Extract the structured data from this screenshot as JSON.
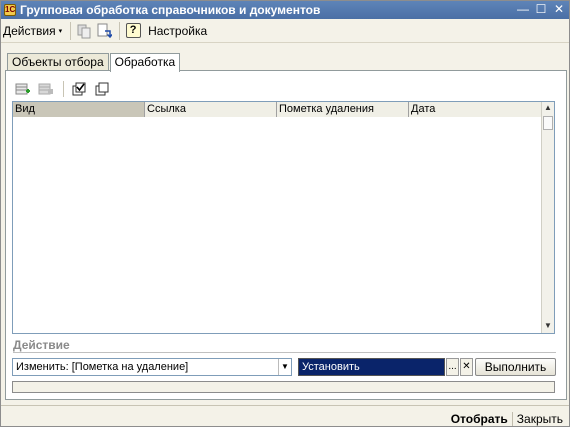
{
  "window": {
    "title": "Групповая обработка справочников и документов",
    "app_icon_glyph": "1С",
    "buttons": {
      "minimize": "—",
      "maximize": "☐",
      "close": "✕"
    }
  },
  "menubar": {
    "actions_label": "Действия",
    "actions_arrow": "▾",
    "help_icon": "?",
    "settings_label": "Настройка"
  },
  "tabs": [
    {
      "label": "Объекты отбора",
      "active": false
    },
    {
      "label": "Обработка",
      "active": true
    }
  ],
  "table": {
    "columns": [
      "Вид",
      "Ссылка",
      "Пометка удаления",
      "Дата"
    ],
    "rows": []
  },
  "action": {
    "section_label": "Действие",
    "operation_value": "Изменить: [Пометка на удаление]",
    "value_field": "Установить",
    "select_button_label": "...",
    "clear_button_label": "✕",
    "execute_label": "Выполнить"
  },
  "footer": {
    "select_label": "Отобрать",
    "close_label": "Закрыть"
  },
  "colors": {
    "titlebar": "#4a6fa5",
    "selection": "#0a246a",
    "window_bg": "#f4f2e8"
  }
}
